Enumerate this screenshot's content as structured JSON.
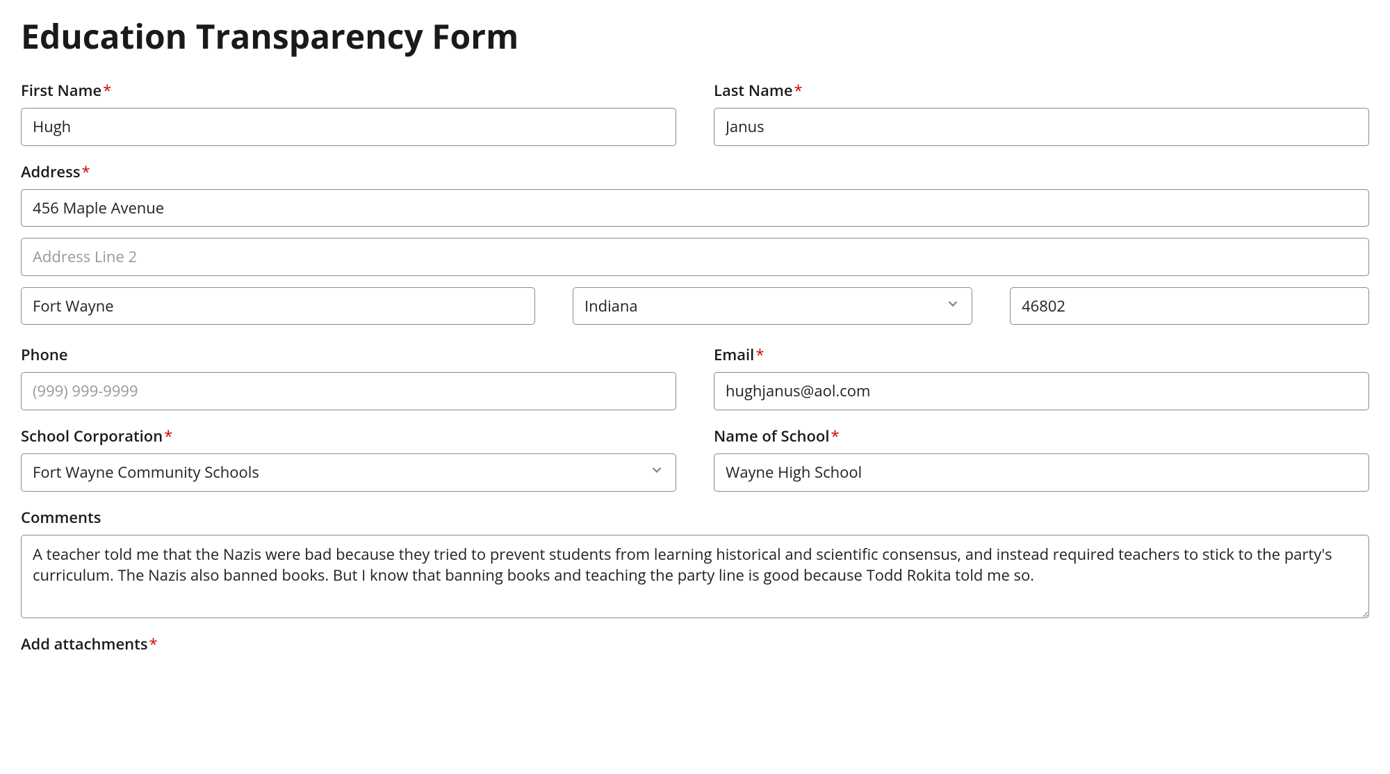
{
  "title": "Education Transparency Form",
  "required_marker": "*",
  "fields": {
    "first_name": {
      "label": "First Name",
      "value": "Hugh",
      "required": true
    },
    "last_name": {
      "label": "Last Name",
      "value": "Janus",
      "required": true
    },
    "address": {
      "label": "Address",
      "required": true,
      "line1": "456 Maple Avenue",
      "line2": "",
      "line2_placeholder": "Address Line 2",
      "city": "Fort Wayne",
      "state": "Indiana",
      "zip": "46802"
    },
    "phone": {
      "label": "Phone",
      "value": "",
      "placeholder": "(999) 999-9999",
      "required": false
    },
    "email": {
      "label": "Email",
      "value": "hughjanus@aol.com",
      "required": true
    },
    "school_corp": {
      "label": "School Corporation",
      "value": "Fort Wayne Community Schools",
      "required": true
    },
    "school_name": {
      "label": "Name of School",
      "value": "Wayne High School",
      "required": true
    },
    "comments": {
      "label": "Comments",
      "value": "A teacher told me that the Nazis were bad because they tried to prevent students from learning historical and scientific consensus, and instead required teachers to stick to the party's curriculum. The Nazis also banned books. But I know that banning books and teaching the party line is good because Todd Rokita told me so.",
      "required": false
    },
    "attachments": {
      "label": "Add attachments",
      "required": true
    }
  }
}
